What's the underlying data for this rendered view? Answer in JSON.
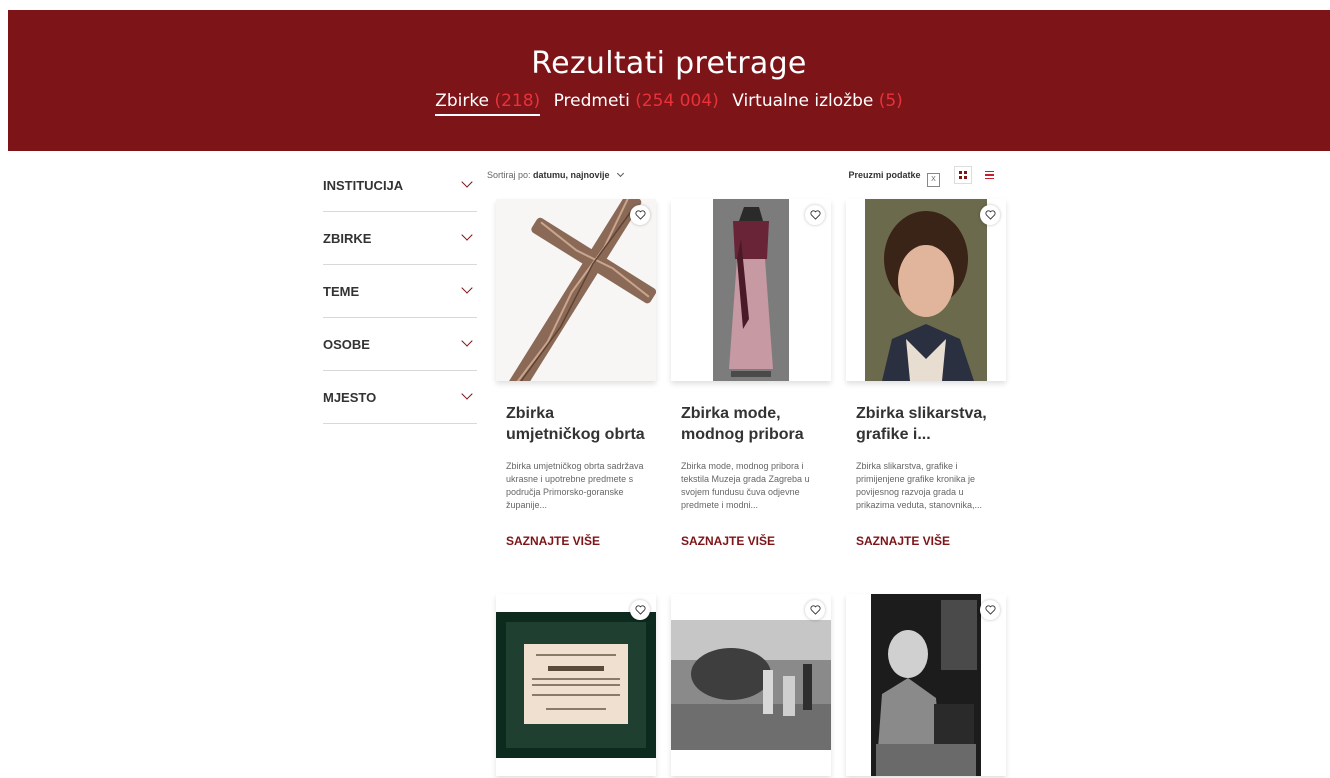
{
  "header": {
    "title": "Rezultati pretrage",
    "tabs": [
      {
        "label": "Zbirke",
        "count": "(218)",
        "active": true
      },
      {
        "label": "Predmeti",
        "count": "(254 004)",
        "active": false
      },
      {
        "label": "Virtualne izložbe",
        "count": "(5)",
        "active": false
      }
    ]
  },
  "filters": [
    "INSTITUCIJA",
    "ZBIRKE",
    "TEME",
    "OSOBE",
    "MJESTO"
  ],
  "toolbar": {
    "sort_prefix": "Sortiraj po:",
    "sort_value": "datumu, najnovije",
    "download_label": "Preuzmi podatke",
    "download_icon": "excel-icon"
  },
  "cards": [
    {
      "title": "Zbirka umjetničkog obrta",
      "desc": "Zbirka umjetničkog obrta sadržava ukrasne i upotrebne predmete s područja Primorsko-goranske županije...",
      "more": "SAZNAJTE VIŠE"
    },
    {
      "title": "Zbirka mode, modnog pribora i...",
      "desc": "Zbirka mode, modnog pribora i tekstila Muzeja grada Zagreba u svojem fundusu čuva odjevne predmete i modni...",
      "more": "SAZNAJTE VIŠE"
    },
    {
      "title": "Zbirka slikarstva, grafike i...",
      "desc": "Zbirka slikarstva, grafike i primijenjene grafike kronika je povijesnog razvoja grada u prikazima veduta, stanovnika,...",
      "more": "SAZNAJTE VIŠE"
    }
  ],
  "colors": {
    "brand": "#7d1418",
    "count_accent": "#e8323a"
  }
}
